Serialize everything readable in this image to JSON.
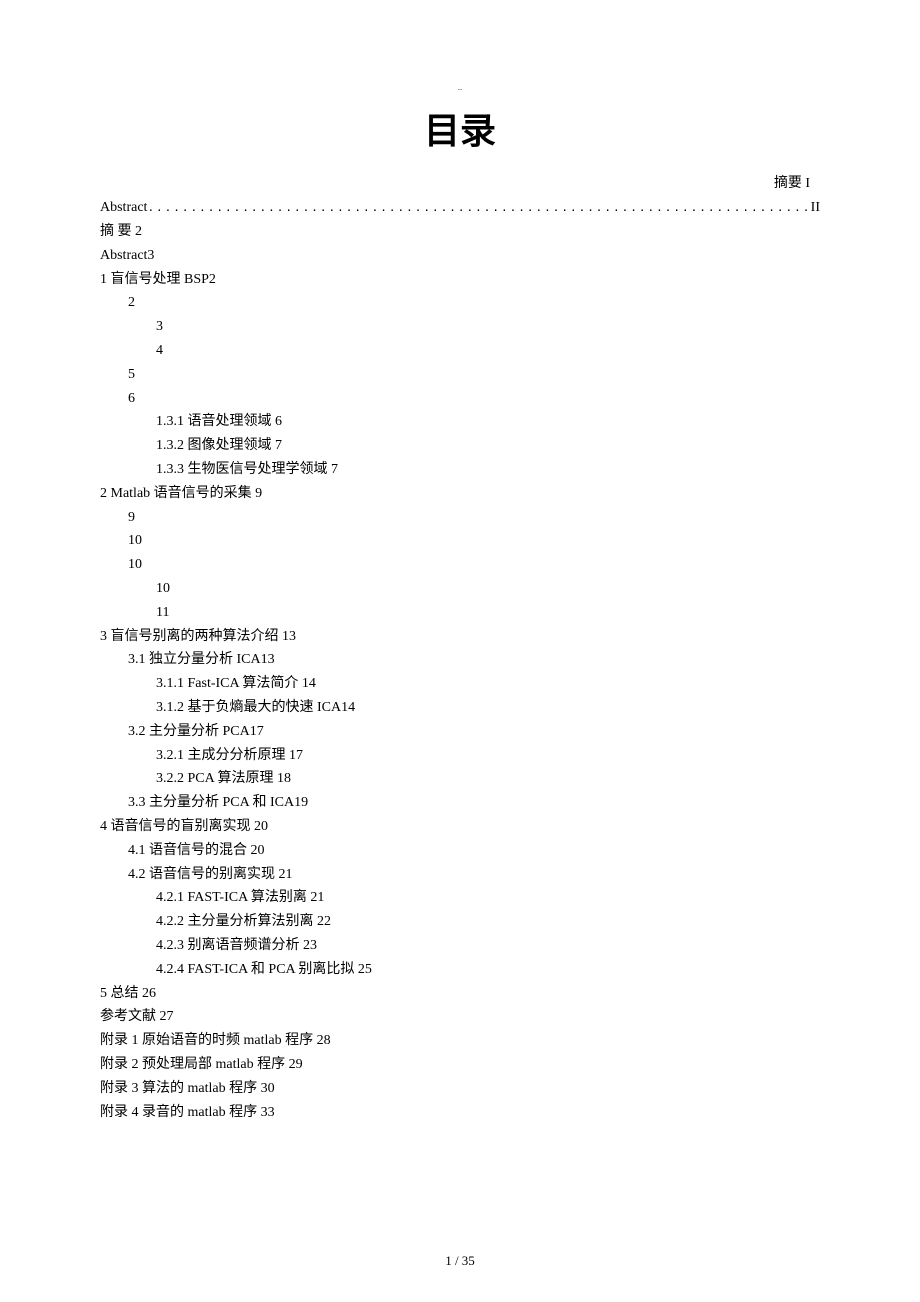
{
  "header_marker": "..",
  "title": "目录",
  "abstract_right": "摘要 I",
  "abstract_dotted": {
    "label": "Abstract",
    "page": "II"
  },
  "entries": [
    {
      "text": "摘 要 2",
      "indent": 0
    },
    {
      "text": "Abstract3",
      "indent": 0
    },
    {
      "text": "1 盲信号处理 BSP2",
      "indent": 0
    },
    {
      "text": "2",
      "indent": 1
    },
    {
      "text": "3",
      "indent": 2
    },
    {
      "text": "4",
      "indent": 2
    },
    {
      "text": "5",
      "indent": 1
    },
    {
      "text": "6",
      "indent": 1
    },
    {
      "text": "1.3.1 语音处理领域 6",
      "indent": 2
    },
    {
      "text": "1.3.2 图像处理领域 7",
      "indent": 2
    },
    {
      "text": "1.3.3 生物医信号处理学领域 7",
      "indent": 2
    },
    {
      "text": "2 Matlab 语音信号的采集 9",
      "indent": 0
    },
    {
      "text": "9",
      "indent": 1
    },
    {
      "text": "10",
      "indent": 1
    },
    {
      "text": "10",
      "indent": 1
    },
    {
      "text": "10",
      "indent": 2
    },
    {
      "text": "11",
      "indent": 2
    },
    {
      "text": "3 盲信号别离的两种算法介绍 13",
      "indent": 0
    },
    {
      "text": "3.1 独立分量分析 ICA13",
      "indent": 1
    },
    {
      "text": "3.1.1 Fast-ICA 算法简介 14",
      "indent": 2
    },
    {
      "text": "3.1.2 基于负熵最大的快速 ICA14",
      "indent": 2
    },
    {
      "text": "3.2 主分量分析 PCA17",
      "indent": 1
    },
    {
      "text": "3.2.1 主成分分析原理 17",
      "indent": 2
    },
    {
      "text": "3.2.2 PCA 算法原理 18",
      "indent": 2
    },
    {
      "text": "3.3 主分量分析 PCA 和 ICA19",
      "indent": 1
    },
    {
      "text": "4 语音信号的盲别离实现 20",
      "indent": 0
    },
    {
      "text": "4.1 语音信号的混合 20",
      "indent": 1
    },
    {
      "text": "4.2 语音信号的别离实现 21",
      "indent": 1
    },
    {
      "text": "4.2.1 FAST-ICA 算法别离 21",
      "indent": 2
    },
    {
      "text": "4.2.2 主分量分析算法别离 22",
      "indent": 2
    },
    {
      "text": "4.2.3 别离语音频谱分析 23",
      "indent": 2
    },
    {
      "text": "4.2.4 FAST-ICA 和 PCA 别离比拟 25",
      "indent": 2
    },
    {
      "text": "5 总结 26",
      "indent": 0
    },
    {
      "text": "参考文献 27",
      "indent": 0
    },
    {
      "text": "附录 1 原始语音的时频 matlab 程序 28",
      "indent": 0
    },
    {
      "text": "附录 2 预处理局部 matlab 程序 29",
      "indent": 0
    },
    {
      "text": "附录 3 算法的 matlab 程序 30",
      "indent": 0
    },
    {
      "text": "附录 4 录音的 matlab 程序 33",
      "indent": 0
    }
  ],
  "dots_fill": "................................................................................................................................",
  "page_footer": "1 / 35"
}
